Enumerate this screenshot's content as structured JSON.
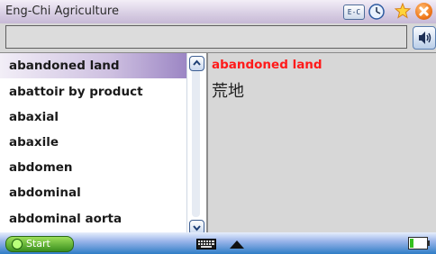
{
  "window": {
    "title": "Eng-Chi Agriculture"
  },
  "toolbar": {
    "ec_label": "E-C"
  },
  "search": {
    "value": ""
  },
  "word_list": {
    "items": [
      {
        "label": "abandoned land"
      },
      {
        "label": "abattoir by product"
      },
      {
        "label": "abaxial"
      },
      {
        "label": "abaxile"
      },
      {
        "label": "abdomen"
      },
      {
        "label": "abdominal"
      },
      {
        "label": "abdominal aorta"
      }
    ]
  },
  "definition": {
    "headword": "abandoned land",
    "translation": "荒地"
  },
  "taskbar": {
    "start_label": "Start"
  },
  "colors": {
    "headword": "#ff1a1a",
    "selected_row": "#9c86c4",
    "taskbar": "#2f7dc6",
    "start_button": "#3a8f1f"
  },
  "icons": {
    "ec": "ec-toggle-icon",
    "clock": "clock-icon",
    "favorite": "star-icon",
    "close": "close-icon",
    "speaker": "speaker-icon",
    "keyboard": "keyboard-icon",
    "up": "up-arrow-icon",
    "battery": "battery-icon"
  }
}
